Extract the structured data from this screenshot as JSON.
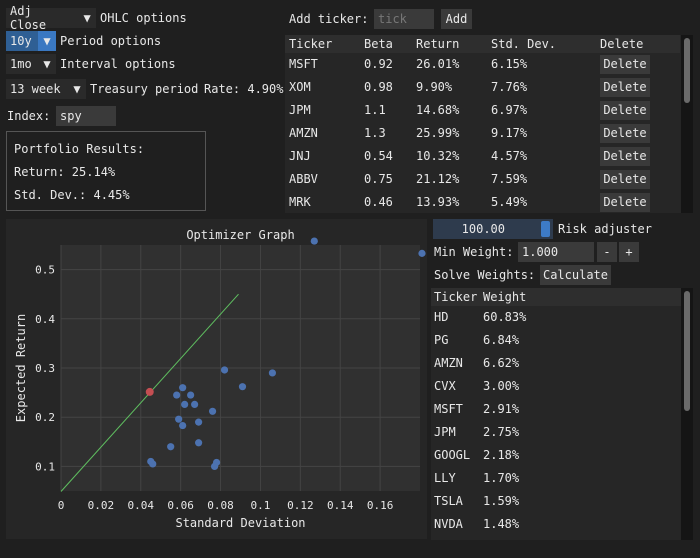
{
  "options": {
    "price_combo": "Adj Close",
    "price_label": "OHLC options",
    "period_combo": "10y",
    "period_label": "Period options",
    "interval_combo": "1mo",
    "interval_label": "Interval options",
    "treasury_combo": "13 week",
    "treasury_label": "Treasury period",
    "rate_text": "Rate: 4.90%",
    "index_label": "Index:",
    "index_value": "spy"
  },
  "results": {
    "title": "Portfolio Results:",
    "return_text": "Return: 25.14%",
    "std_text": "Std. Dev.: 4.45%"
  },
  "ticker": {
    "add_label": "Add ticker:",
    "placeholder": "tick",
    "add_button": "Add",
    "headers": [
      "Ticker",
      "Beta",
      "Return",
      "Std. Dev.",
      "Delete"
    ],
    "delete_label": "Delete",
    "rows": [
      {
        "ticker": "MSFT",
        "beta": "0.92",
        "ret": "26.01%",
        "std": "6.15%"
      },
      {
        "ticker": "XOM",
        "beta": "0.98",
        "ret": "9.90%",
        "std": "7.76%"
      },
      {
        "ticker": "JPM",
        "beta": "1.1",
        "ret": "14.68%",
        "std": "6.97%"
      },
      {
        "ticker": "AMZN",
        "beta": "1.3",
        "ret": "25.99%",
        "std": "9.17%"
      },
      {
        "ticker": "JNJ",
        "beta": "0.54",
        "ret": "10.32%",
        "std": "4.57%"
      },
      {
        "ticker": "ABBV",
        "beta": "0.75",
        "ret": "21.12%",
        "std": "7.59%"
      },
      {
        "ticker": "MRK",
        "beta": "0.46",
        "ret": "13.93%",
        "std": "5.49%"
      }
    ]
  },
  "controls": {
    "risk_value": "100.00",
    "risk_label": "Risk adjuster",
    "min_weight_label": "Min Weight:",
    "min_weight_value": "1.000",
    "minus": "-",
    "plus": "+",
    "solve_label": "Solve Weights:",
    "calculate": "Calculate"
  },
  "weights": {
    "headers": [
      "Ticker",
      "Weight"
    ],
    "rows": [
      {
        "ticker": "HD",
        "weight": "60.83%"
      },
      {
        "ticker": "PG",
        "weight": "6.84%"
      },
      {
        "ticker": "AMZN",
        "weight": "6.62%"
      },
      {
        "ticker": "CVX",
        "weight": "3.00%"
      },
      {
        "ticker": "MSFT",
        "weight": "2.91%"
      },
      {
        "ticker": "JPM",
        "weight": "2.75%"
      },
      {
        "ticker": "GOOGL",
        "weight": "2.18%"
      },
      {
        "ticker": "LLY",
        "weight": "1.70%"
      },
      {
        "ticker": "TSLA",
        "weight": "1.59%"
      },
      {
        "ticker": "NVDA",
        "weight": "1.48%"
      }
    ]
  },
  "chart_data": {
    "type": "scatter",
    "title": "Optimizer Graph",
    "xlabel": "Standard Deviation",
    "ylabel": "Expected Return",
    "xlim": [
      0,
      0.18
    ],
    "ylim": [
      0.05,
      0.55
    ],
    "xticks": [
      "0",
      "0.02",
      "0.04",
      "0.06",
      "0.08",
      "0.1",
      "0.12",
      "0.14",
      "0.16"
    ],
    "yticks": [
      "0.1",
      "0.2",
      "0.3",
      "0.4",
      "0.5"
    ],
    "line": {
      "x": [
        0,
        0.089
      ],
      "y": [
        0.049,
        0.45
      ],
      "color": "#5fbf60"
    },
    "points": [
      {
        "x": 0.127,
        "y": 0.558
      },
      {
        "x": 0.181,
        "y": 0.533
      },
      {
        "x": 0.082,
        "y": 0.296
      },
      {
        "x": 0.106,
        "y": 0.29
      },
      {
        "x": 0.091,
        "y": 0.262
      },
      {
        "x": 0.061,
        "y": 0.26
      },
      {
        "x": 0.058,
        "y": 0.245
      },
      {
        "x": 0.065,
        "y": 0.245
      },
      {
        "x": 0.067,
        "y": 0.226
      },
      {
        "x": 0.062,
        "y": 0.226
      },
      {
        "x": 0.076,
        "y": 0.212
      },
      {
        "x": 0.059,
        "y": 0.196
      },
      {
        "x": 0.061,
        "y": 0.183
      },
      {
        "x": 0.069,
        "y": 0.19
      },
      {
        "x": 0.069,
        "y": 0.148
      },
      {
        "x": 0.055,
        "y": 0.14
      },
      {
        "x": 0.045,
        "y": 0.11
      },
      {
        "x": 0.046,
        "y": 0.105
      },
      {
        "x": 0.078,
        "y": 0.108
      },
      {
        "x": 0.077,
        "y": 0.1
      }
    ],
    "optimal": {
      "x": 0.0445,
      "y": 0.2514
    },
    "point_color": "#4c72b0",
    "optimal_color": "#c44e52"
  }
}
